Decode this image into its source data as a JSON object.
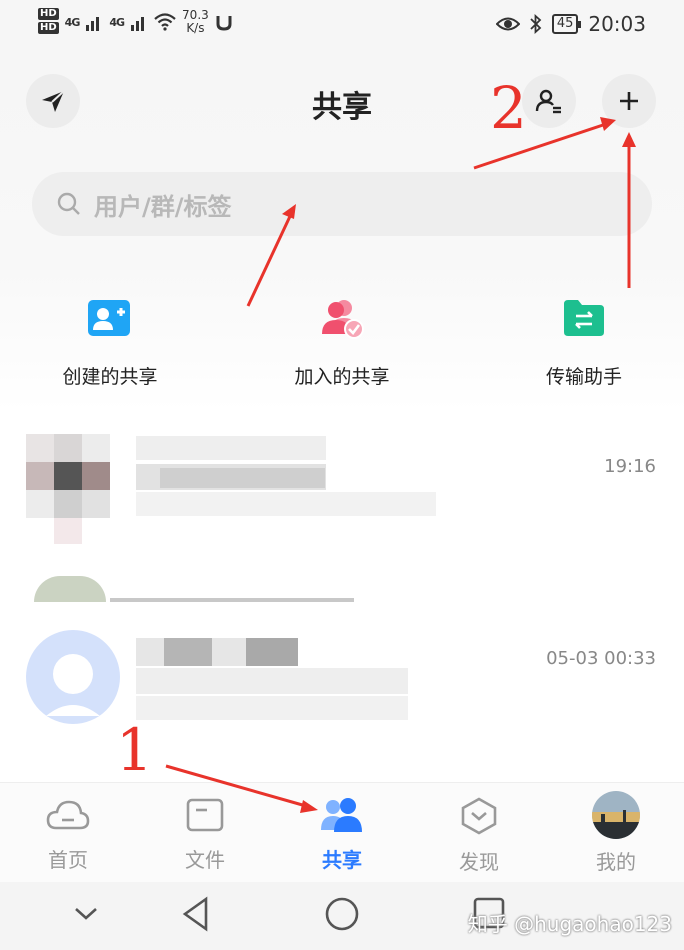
{
  "status_bar": {
    "hd1": "HD",
    "hd2": "HD",
    "net1": "4G",
    "net2": "4G",
    "speed_value": "70.3",
    "speed_unit": "K/s",
    "battery": "45",
    "time": "20:03"
  },
  "header": {
    "title": "共享",
    "search_placeholder": "用户/群/标签"
  },
  "quick_actions": [
    {
      "label": "创建的共享",
      "icon": "add-user-icon",
      "color": "#1fa5f5"
    },
    {
      "label": "加入的共享",
      "icon": "joined-group-icon",
      "color": "#f0506e"
    },
    {
      "label": "传输助手",
      "icon": "transfer-folder-icon",
      "color": "#1dbf8f"
    }
  ],
  "list": [
    {
      "time": "19:16"
    },
    {
      "time": "05-03 00:33"
    }
  ],
  "tabs": [
    {
      "label": "首页",
      "icon": "cloud-icon",
      "active": false
    },
    {
      "label": "文件",
      "icon": "folder-icon",
      "active": false
    },
    {
      "label": "共享",
      "icon": "people-icon",
      "active": true
    },
    {
      "label": "发现",
      "icon": "discover-icon",
      "active": false
    },
    {
      "label": "我的",
      "icon": "avatar-icon",
      "active": false
    }
  ],
  "annotations": {
    "one": "1",
    "two": "2"
  },
  "watermark": "知乎 @hugaohao123",
  "colors": {
    "accent": "#2b7bff",
    "annotation": "#e8332b"
  }
}
